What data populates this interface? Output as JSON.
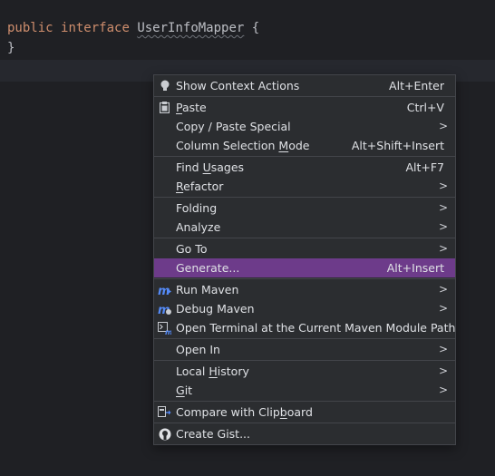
{
  "editor": {
    "line1_kw1": "public",
    "line1_kw2": "interface",
    "line1_class": "UserInfoMapper",
    "line1_brace": "{",
    "line2": "}"
  },
  "menu": {
    "show_context_actions": {
      "label": "Show Context Actions",
      "shortcut": "Alt+Enter",
      "icon": "bulb-icon"
    },
    "paste": {
      "label_pre": "",
      "label_u": "P",
      "label_post": "aste",
      "shortcut": "Ctrl+V",
      "icon": "clipboard-icon"
    },
    "copy_paste_special": {
      "label": "Copy / Paste Special"
    },
    "column_selection_mode": {
      "label_pre": "Column Selection ",
      "label_u": "M",
      "label_post": "ode",
      "shortcut": "Alt+Shift+Insert"
    },
    "find_usages": {
      "label_pre": "Find ",
      "label_u": "U",
      "label_post": "sages",
      "shortcut": "Alt+F7"
    },
    "refactor": {
      "label_pre": "",
      "label_u": "R",
      "label_post": "efactor"
    },
    "folding": {
      "label": "Folding"
    },
    "analyze": {
      "label": "Analyze"
    },
    "go_to": {
      "label": "Go To"
    },
    "generate": {
      "label": "Generate...",
      "shortcut": "Alt+Insert"
    },
    "run_maven": {
      "label": "Run Maven",
      "icon": "maven-run-icon"
    },
    "debug_maven": {
      "label": "Debug Maven",
      "icon": "maven-debug-icon"
    },
    "open_terminal": {
      "label": "Open Terminal at the Current Maven Module Path",
      "icon": "terminal-icon"
    },
    "open_in": {
      "label": "Open In"
    },
    "local_history": {
      "label_pre": "Local ",
      "label_u": "H",
      "label_post": "istory"
    },
    "git": {
      "label_pre": "",
      "label_u": "G",
      "label_post": "it"
    },
    "compare_clipboard": {
      "label_pre": "Compare with Clip",
      "label_u": "b",
      "label_post": "oard",
      "icon": "compare-icon"
    },
    "create_gist": {
      "label": "Create Gist...",
      "icon": "github-icon"
    },
    "submenu_arrow": ">"
  },
  "colors": {
    "editor_bg": "#1f2024",
    "menu_bg": "#2b2d30",
    "selection": "#6d3b8a",
    "keyword": "#cf8e6d"
  }
}
